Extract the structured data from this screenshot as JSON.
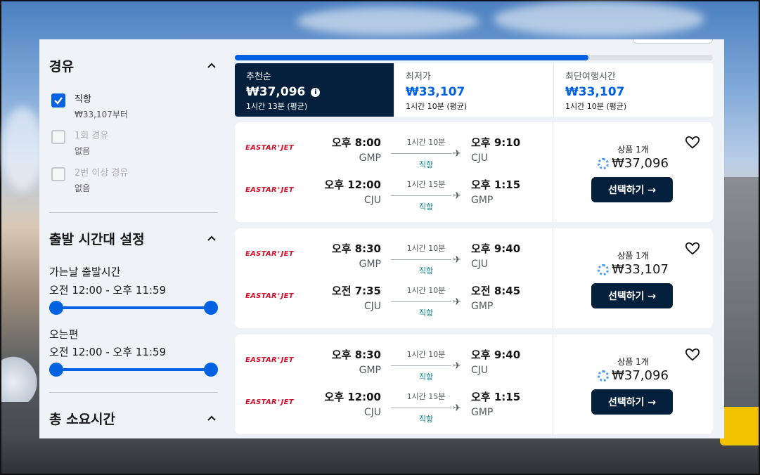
{
  "sidebar": {
    "stops": {
      "title": "경유",
      "options": [
        {
          "label": "직항",
          "sub": "₩33,107부터",
          "checked": true
        },
        {
          "label": "1회 경유",
          "sub": "없음",
          "checked": false
        },
        {
          "label": "2번 이상 경유",
          "sub": "없음",
          "checked": false
        }
      ]
    },
    "departure_times": {
      "title": "출발 시간대 설정",
      "outbound_label": "가는날 출발시간",
      "outbound_range": "오전 12:00 - 오후 11:59",
      "return_label": "오는편",
      "return_range": "오전 12:00 - 오후 11:59"
    },
    "duration": {
      "title": "총 소요시간"
    }
  },
  "progress": 0.74,
  "sort_tabs": [
    {
      "name": "추천순",
      "price": "₩37,096",
      "sub": "1시간 13분 (평균)",
      "active": true
    },
    {
      "name": "최저가",
      "price": "₩33,107",
      "sub": "1시간 10분 (평균)",
      "active": false
    },
    {
      "name": "최단여행시간",
      "price": "₩33,107",
      "sub": "1시간 10분 (평균)",
      "active": false
    }
  ],
  "results": [
    {
      "legs": [
        {
          "airline": "EASTAR⁺JET",
          "dep_time": "오후 8:00",
          "dep_code": "GMP",
          "duration": "1시간 10분",
          "stops": "직항",
          "arr_time": "오후 9:10",
          "arr_code": "CJU"
        },
        {
          "airline": "EASTAR⁺JET",
          "dep_time": "오후 12:00",
          "dep_code": "CJU",
          "duration": "1시간 15분",
          "stops": "직항",
          "arr_time": "오후 1:15",
          "arr_code": "GMP"
        }
      ],
      "deals": "상품 1개",
      "price": "₩37,096",
      "button": "선택하기 →"
    },
    {
      "legs": [
        {
          "airline": "EASTAR⁺JET",
          "dep_time": "오후 8:30",
          "dep_code": "GMP",
          "duration": "1시간 10분",
          "stops": "직항",
          "arr_time": "오후 9:40",
          "arr_code": "CJU"
        },
        {
          "airline": "EASTAR⁺JET",
          "dep_time": "오전 7:35",
          "dep_code": "CJU",
          "duration": "1시간 10분",
          "stops": "직항",
          "arr_time": "오전 8:45",
          "arr_code": "GMP"
        }
      ],
      "deals": "상품 1개",
      "price": "₩33,107",
      "button": "선택하기 →"
    },
    {
      "legs": [
        {
          "airline": "EASTAR⁺JET",
          "dep_time": "오후 8:30",
          "dep_code": "GMP",
          "duration": "1시간 10분",
          "stops": "직항",
          "arr_time": "오후 9:40",
          "arr_code": "CJU"
        },
        {
          "airline": "EASTAR⁺JET",
          "dep_time": "오후 12:00",
          "dep_code": "CJU",
          "duration": "1시간 15분",
          "stops": "직항",
          "arr_time": "오후 1:15",
          "arr_code": "GMP"
        }
      ],
      "deals": "상품 1개",
      "price": "₩37,096",
      "button": "선택하기 →"
    }
  ],
  "colors": {
    "accent": "#0062e3",
    "dark": "#05203c",
    "airline": "#d1112b",
    "direct": "#0c838a"
  }
}
